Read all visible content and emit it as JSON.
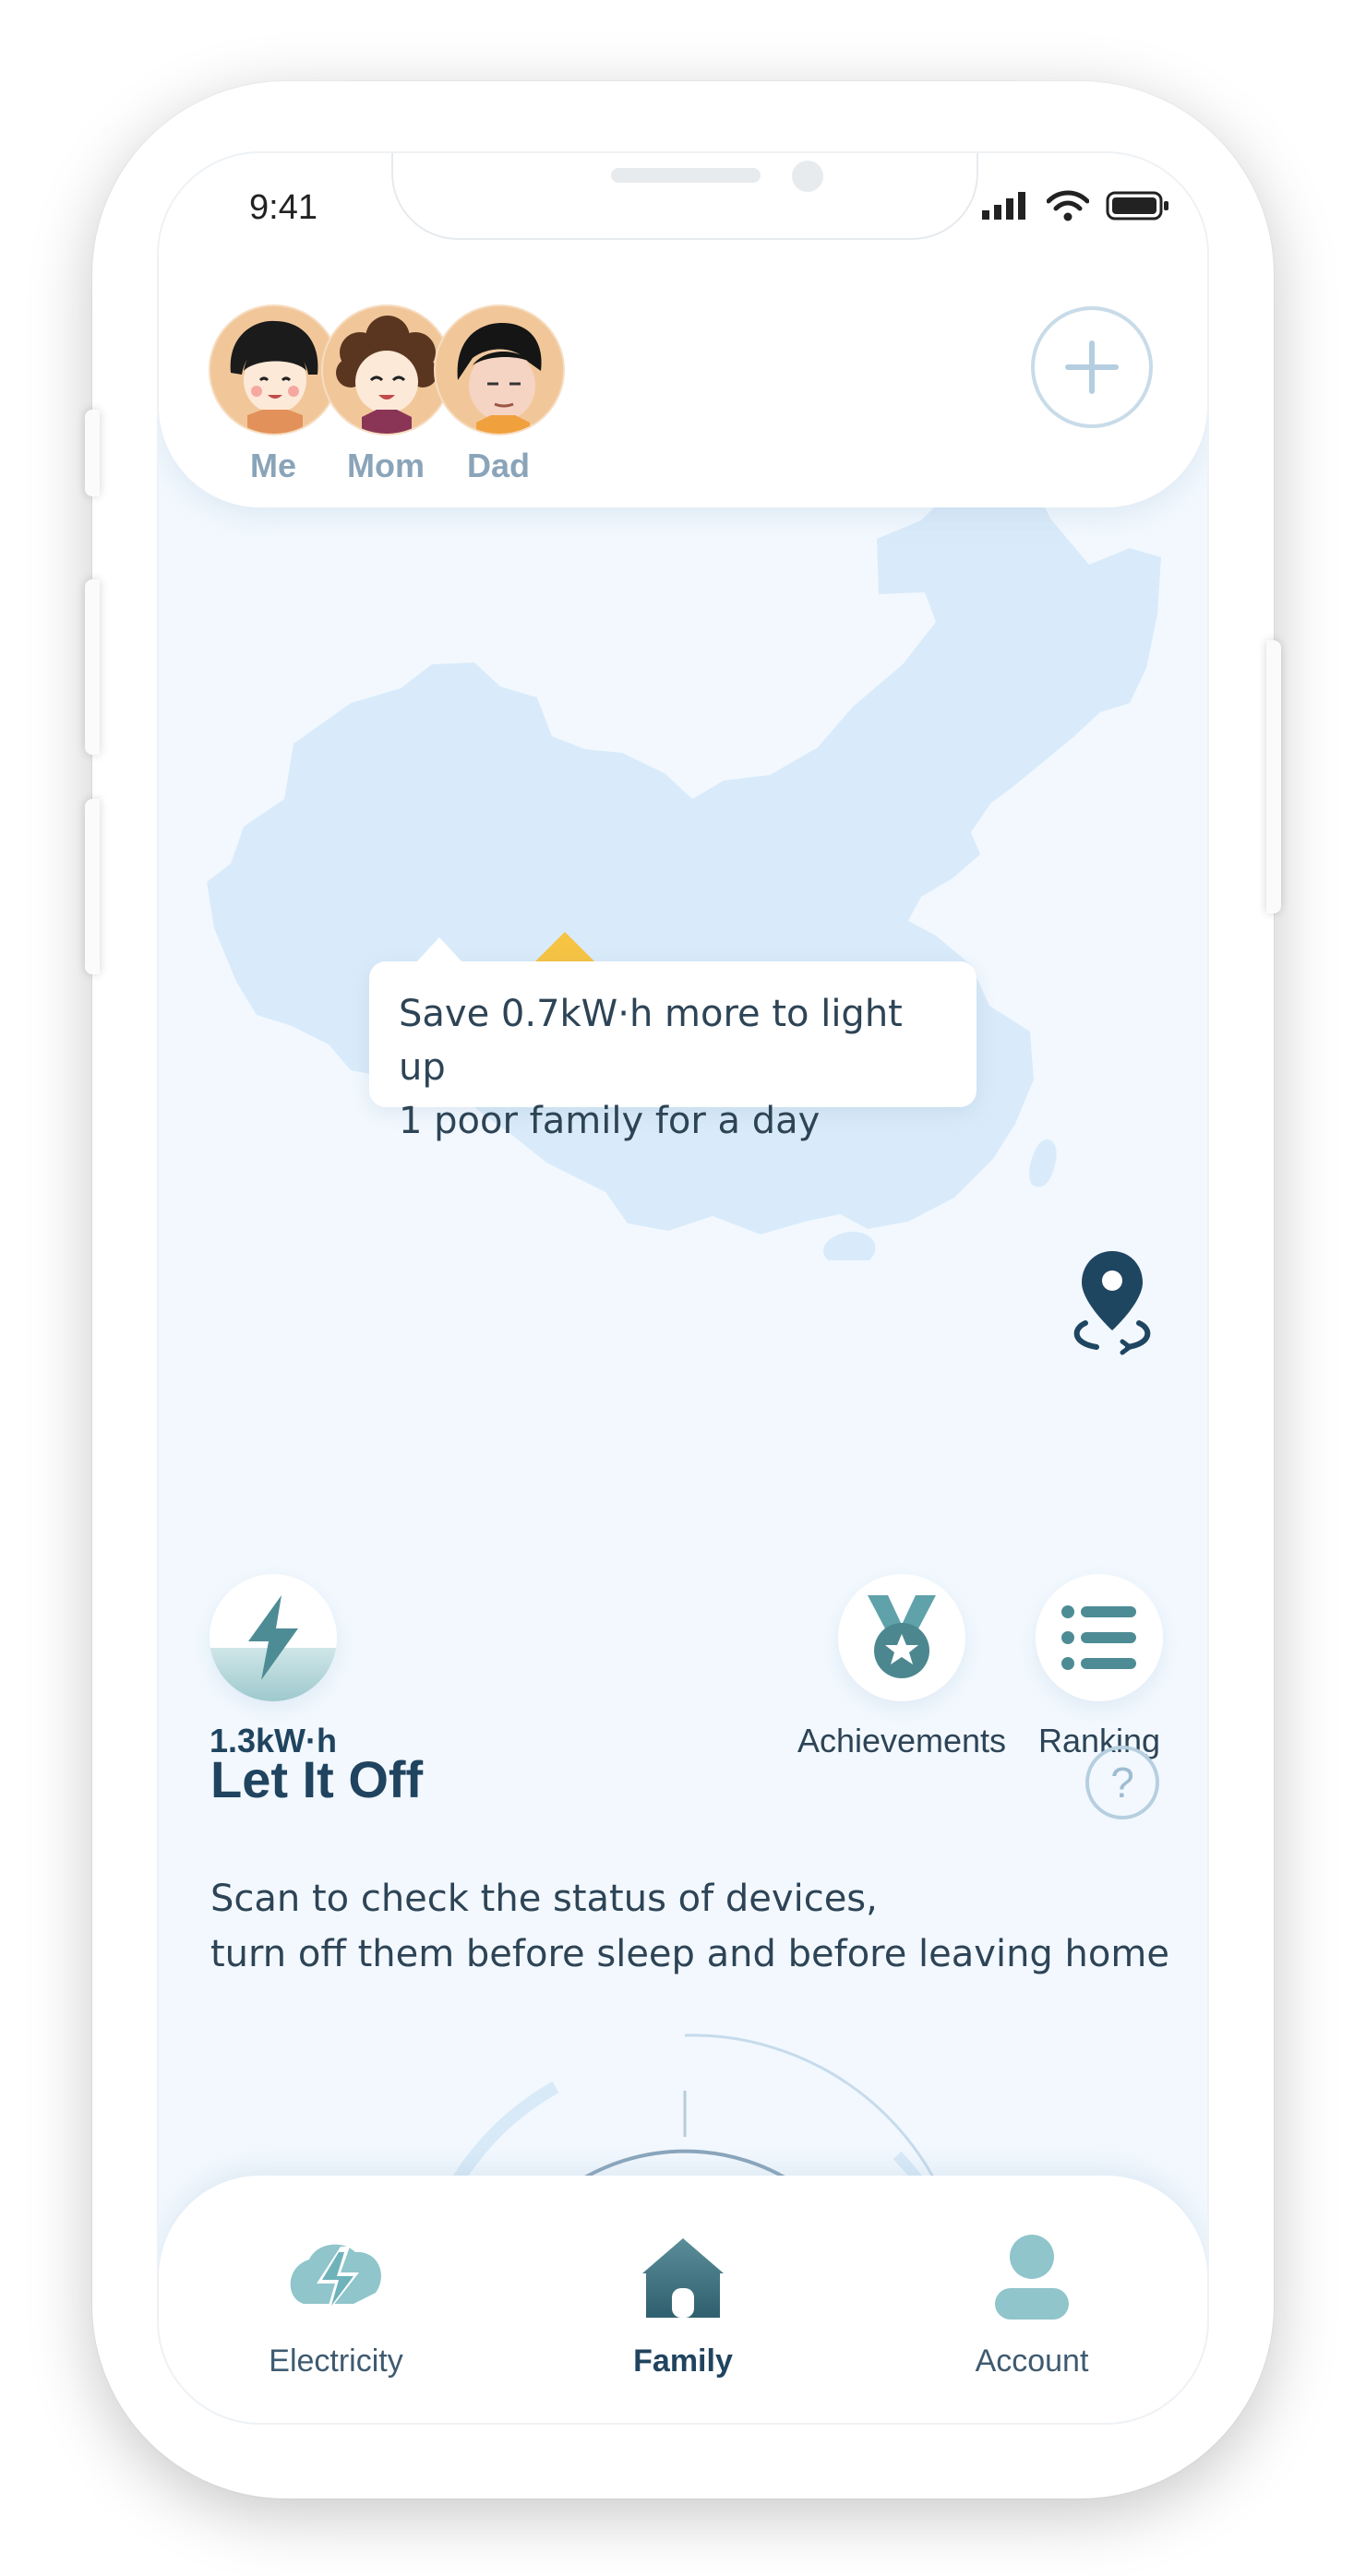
{
  "status_bar": {
    "time": "9:41"
  },
  "family": {
    "members": [
      {
        "name": "Me",
        "avatar_icon": "girl-avatar-icon"
      },
      {
        "name": "Mom",
        "avatar_icon": "mom-avatar-icon"
      },
      {
        "name": "Dad",
        "avatar_icon": "dad-avatar-icon"
      }
    ],
    "add_icon": "plus-icon"
  },
  "map": {
    "tooltip": {
      "line1": "Save 0.7kW·h more to light up",
      "line2": "1 poor family for a day"
    },
    "markers": [
      {
        "icon": "house-marker-gray-icon"
      },
      {
        "icon": "house-marker-yellow-icon",
        "color": "#f6c343"
      }
    ],
    "locate_icon": "location-pin-icon"
  },
  "stats": {
    "energy": {
      "value": "1.3kW·h",
      "icon": "lightning-icon",
      "fill_level": 0.42
    },
    "achievements": {
      "label": "Achievements",
      "icon": "medal-icon"
    },
    "ranking": {
      "label": "Ranking",
      "icon": "list-icon"
    }
  },
  "let_it_off": {
    "title": "Let It Off",
    "help_symbol": "?",
    "desc_line1": "Scan to check the status of devices,",
    "desc_line2": "turn off them before sleep and before leaving home"
  },
  "tabs": [
    {
      "label": "Electricity",
      "icon": "electricity-icon",
      "active": false
    },
    {
      "label": "Family",
      "icon": "home-icon",
      "active": true
    },
    {
      "label": "Account",
      "icon": "person-icon",
      "active": false
    }
  ],
  "colors": {
    "background": "#f2f8fe",
    "map_fill": "#d9ebfa",
    "accent_teal": "#5fa2aa",
    "dark_navy": "#20445f",
    "marker_yellow": "#f6c343"
  }
}
